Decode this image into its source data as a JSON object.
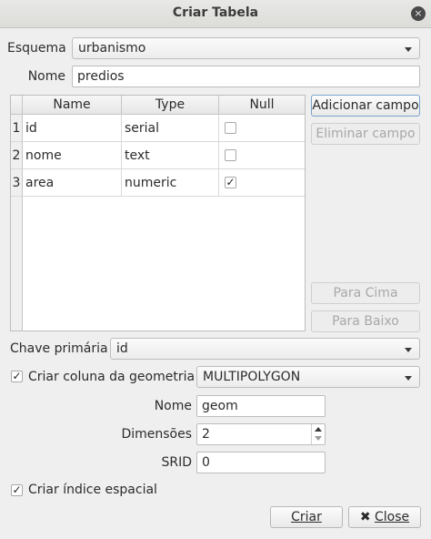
{
  "window": {
    "title": "Criar Tabela",
    "close_glyph": "×"
  },
  "schema": {
    "label": "Esquema",
    "value": "urbanismo"
  },
  "name": {
    "label": "Nome",
    "value": "predios"
  },
  "fields_table": {
    "columns": [
      "Name",
      "Type",
      "Null"
    ],
    "rows": [
      {
        "num": "1",
        "name": "id",
        "type": "serial",
        "null": false,
        "null_glyph": ""
      },
      {
        "num": "2",
        "name": "nome",
        "type": "text",
        "null": false,
        "null_glyph": ""
      },
      {
        "num": "3",
        "name": "area",
        "type": "numeric",
        "null": true,
        "null_glyph": "✓"
      }
    ]
  },
  "buttons": {
    "add_field": "Adicionar campo",
    "remove_field": "Eliminar campo",
    "move_up": "Para Cima",
    "move_down": "Para Baixo",
    "create": "Criar",
    "close": "Close",
    "close_icon_glyph": "✖"
  },
  "primary_key": {
    "label": "Chave primária",
    "value": "id"
  },
  "geometry": {
    "checkbox_label": "Criar coluna da geometria",
    "checked": true,
    "check_glyph": "✓",
    "type_value": "MULTIPOLYGON",
    "name_label": "Nome",
    "name_value": "geom",
    "dimensions_label": "Dimensões",
    "dimensions_value": "2",
    "srid_label": "SRID",
    "srid_value": "0"
  },
  "spatial_index": {
    "label": "Criar índice espacial",
    "checked": true,
    "check_glyph": "✓"
  },
  "colors": {
    "accent_focus": "#7aa3cf",
    "disabled_text": "#a8a8a8",
    "window_bg": "#efefef"
  }
}
